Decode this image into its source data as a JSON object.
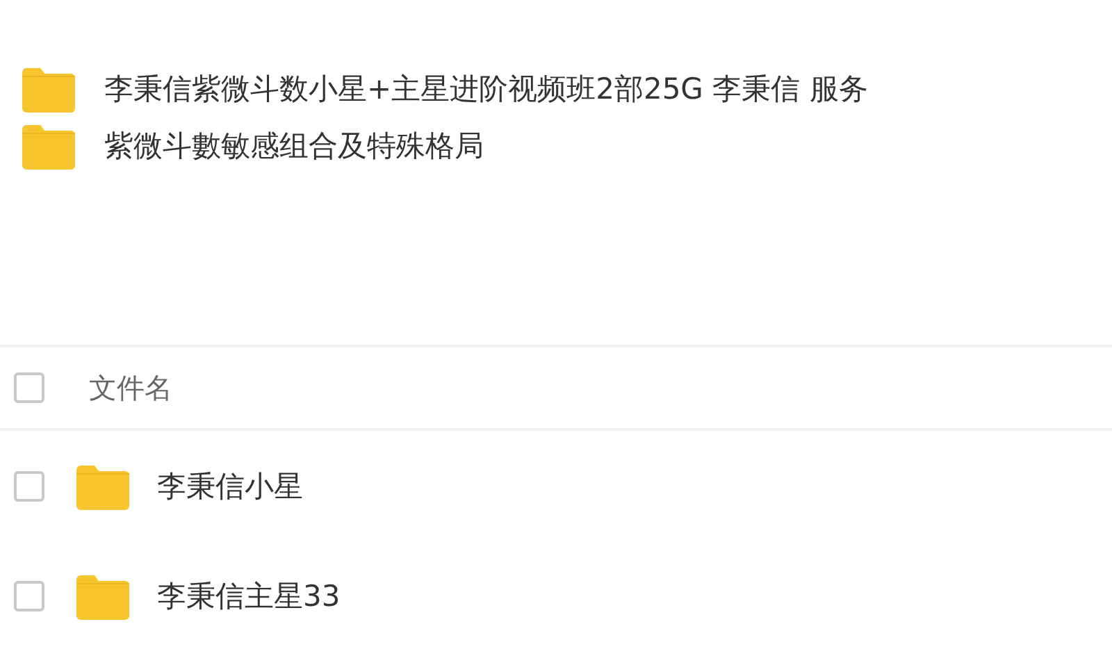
{
  "folders": [
    {
      "name": "李秉信紫微斗数小星+主星进阶视频班2部25G 李秉信 服务"
    },
    {
      "name": "紫微斗數敏感组合及特殊格局"
    }
  ],
  "file_list": {
    "header": {
      "label": "文件名",
      "checked": false
    },
    "rows": [
      {
        "name": "李秉信小星",
        "checked": false
      },
      {
        "name": "李秉信主星33",
        "checked": false
      }
    ]
  }
}
